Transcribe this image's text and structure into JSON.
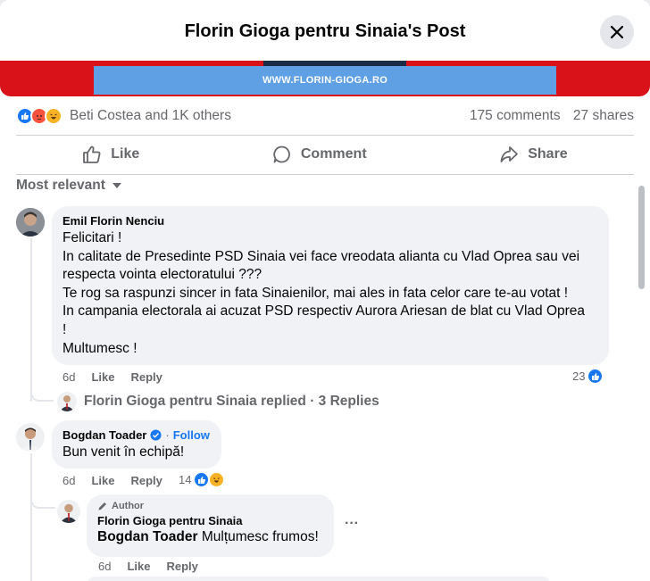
{
  "header": {
    "title": "Florin Gioga pentru Sinaia's Post"
  },
  "post": {
    "banner_text": "WWW.FLORIN-GIOGA.RO"
  },
  "stats": {
    "reactions_text": "Beti Costea and 1K others",
    "comments": "175 comments",
    "shares": "27 shares"
  },
  "actions": {
    "like": "Like",
    "comment": "Comment",
    "share": "Share"
  },
  "sort_label": "Most relevant",
  "comments": [
    {
      "author": "Emil Florin Nenciu",
      "lines": [
        "Felicitari !",
        "In calitate de Presedinte PSD Sinaia vei face vreodata alianta cu Vlad Oprea sau vei",
        "respecta vointa electoratului ???",
        "Te rog sa raspunzi sincer in fata Sinaienilor, mai ales in fata celor care te-au votat !",
        "In campania electorala ai acuzat PSD respectiv Aurora Ariesan de blat cu Vlad Oprea",
        "!",
        "Multumesc !"
      ],
      "time": "6d",
      "like": "Like",
      "reply": "Reply",
      "reactions": "23",
      "replied_text": "Florin Gioga pentru Sinaia replied · 3 Replies"
    },
    {
      "author": "Bogdan Toader",
      "follow": "Follow",
      "text": "Bun venit în echipă!",
      "time": "6d",
      "like": "Like",
      "reply": "Reply",
      "reactions": "14"
    }
  ],
  "reply": {
    "badge": "Author",
    "author": "Florin Gioga pentru Sinaia",
    "mention": "Bogdan Toader",
    "text": "Mulțumesc frumos!",
    "time": "6d",
    "like": "Like",
    "reply": "Reply",
    "more": "···"
  }
}
